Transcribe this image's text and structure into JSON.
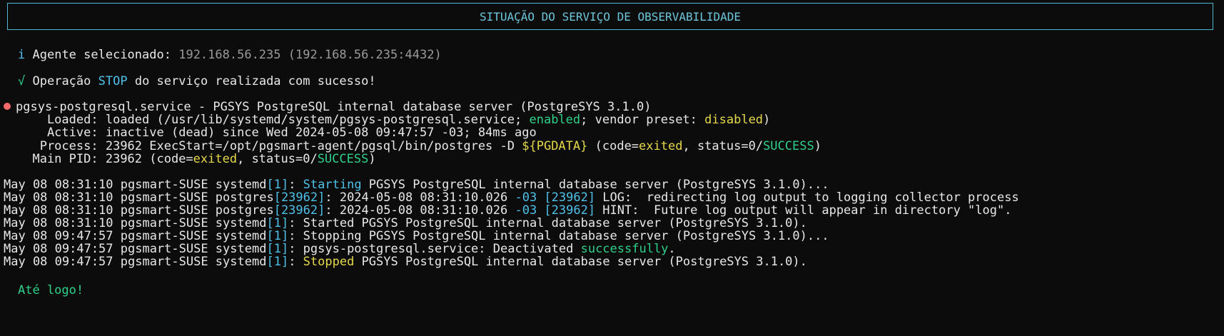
{
  "header": {
    "title": "SITUAÇÃO DO SERVIÇO DE OBSERVABILIDADE"
  },
  "agent": {
    "icon": "i",
    "label": "Agente selecionado:",
    "value": "192.168.56.235 (192.168.56.235:4432)"
  },
  "operation": {
    "icon": "√",
    "pre": "Operação",
    "action": "STOP",
    "post": "do serviço realizada com sucesso!"
  },
  "status": {
    "title": "pgsys-postgresql.service - PGSYS PostgreSQL internal database server (PostgreSYS 3.1.0)",
    "loaded_label": "    Loaded:",
    "loaded_pre": "loaded (/usr/lib/systemd/system/pgsys-postgresql.service;",
    "loaded_enabled": "enabled",
    "loaded_mid": "; vendor preset:",
    "loaded_disabled": "disabled",
    "loaded_end": ")",
    "active_label": "    Active:",
    "active_value": "inactive (dead) since Wed 2024-05-08 09:47:57 -03; 84ms ago",
    "process_label": "   Process:",
    "process_pre": "23962 ExecStart=/opt/pgsmart-agent/pgsql/bin/postgres -D",
    "process_var": "${PGDATA}",
    "process_code": "(code=",
    "process_exited": "exited",
    "process_status": ", status=0/",
    "process_success": "SUCCESS",
    "process_end": ")",
    "pid_label": "  Main PID:",
    "pid_pre": "23962 (code=",
    "pid_exited": "exited",
    "pid_status": ", status=0/",
    "pid_success": "SUCCESS",
    "pid_end": ")"
  },
  "logs": [
    {
      "prefix": "May 08 08:31:10 pgsmart-SUSE systemd",
      "pid": "[1]",
      "a": ": ",
      "kw": "Starting",
      "kw_color": "cyan",
      "rest": " PGSYS PostgreSQL internal database server (PostgreSYS 3.1.0)..."
    },
    {
      "prefix": "May 08 08:31:10 pgsmart-SUSE postgres",
      "pid": "[23962]",
      "a": ": 2024-05-08 08:31:10.026 ",
      "kw": "-03 [23962]",
      "kw_color": "cyan",
      "rest": " LOG:  redirecting log output to logging collector process"
    },
    {
      "prefix": "May 08 08:31:10 pgsmart-SUSE postgres",
      "pid": "[23962]",
      "a": ": 2024-05-08 08:31:10.026 ",
      "kw": "-03 [23962]",
      "kw_color": "cyan",
      "rest": " HINT:  Future log output will appear in directory \"log\"."
    },
    {
      "prefix": "May 08 08:31:10 pgsmart-SUSE systemd",
      "pid": "[1]",
      "a": ": Started PGSYS PostgreSQL internal database server (PostgreSYS 3.1.0).",
      "kw": "",
      "kw_color": "",
      "rest": ""
    },
    {
      "prefix": "May 08 09:47:57 pgsmart-SUSE systemd",
      "pid": "[1]",
      "a": ": Stopping PGSYS PostgreSQL internal database server (PostgreSYS 3.1.0)...",
      "kw": "",
      "kw_color": "",
      "rest": ""
    },
    {
      "prefix": "May 08 09:47:57 pgsmart-SUSE systemd",
      "pid": "[1]",
      "a": ": pgsys-postgresql.service: Deactivated ",
      "kw": "successfully",
      "kw_color": "green",
      "rest": "."
    },
    {
      "prefix": "May 08 09:47:57 pgsmart-SUSE systemd",
      "pid": "[1]",
      "a": ": ",
      "kw": "Stopped",
      "kw_color": "yellow",
      "rest": " PGSYS PostgreSQL internal database server (PostgreSYS 3.1.0)."
    }
  ],
  "footer": {
    "goodbye": "Até logo!"
  },
  "colors": {
    "border": "#4fb8d0",
    "cyan": "#4fc1e9",
    "green": "#2fd08a",
    "yellow": "#e6d84a",
    "bullet": "#f36a6a"
  }
}
